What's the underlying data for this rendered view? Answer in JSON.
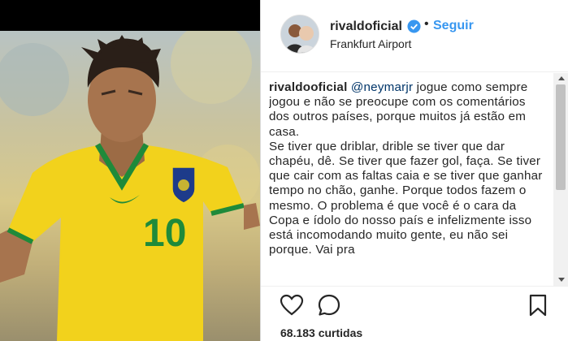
{
  "post": {
    "media_alt": "Neymar jersey photo"
  },
  "jersey": {
    "number": "10"
  },
  "header": {
    "username": "rivaldoficial",
    "follow_label": "Seguir",
    "separator": "•",
    "location": "Frankfurt Airport"
  },
  "caption": {
    "username": "rivaldooficial",
    "mention": "@neymarjr",
    "paragraph1": "jogue como sempre jogou e não se preocupe com os comentários dos outros países, porque muitos já estão em casa.",
    "paragraph2": "Se tiver que driblar, drible se tiver que dar chapéu, dê. Se tiver que fazer gol, faça. Se tiver que cair com as faltas caia e se tiver que ganhar tempo no chão, ganhe. Porque todos fazem o mesmo. O problema é que você é o cara da Copa e ídolo do nosso país e infelizmente isso está incomodando muito gente, eu não sei porque. Vai pra"
  },
  "likes": {
    "text": "68.183 curtidas"
  },
  "icons": {
    "like": "heart-icon",
    "comment": "comment-icon",
    "save": "bookmark-icon",
    "verified": "verified-badge-icon"
  },
  "colors": {
    "follow": "#3897f0",
    "verified": "#3897f0",
    "jersey_yellow": "#f2d21c",
    "jersey_green": "#1f8a3a"
  }
}
